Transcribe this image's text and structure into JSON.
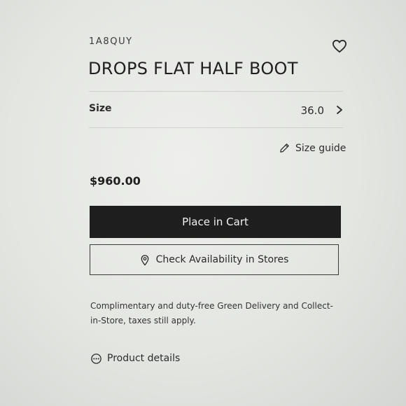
{
  "product": {
    "sku": "1A8QUY",
    "title": "DROPS FLAT HALF BOOT",
    "price": "$960.00"
  },
  "size": {
    "label": "Size",
    "value": "36.0"
  },
  "size_guide": {
    "label": "Size guide"
  },
  "actions": {
    "cart_label": "Place in Cart",
    "stores_label": "Check Availability in Stores"
  },
  "delivery_info": "Complimentary and duty-free Green Delivery and Collect-in-Store, taxes still apply.",
  "details": {
    "label": "Product details"
  },
  "icons": {
    "wishlist": "heart-icon",
    "size_chevron": "chevron-right-icon",
    "size_guide": "pencil-icon",
    "stores": "location-pin-icon",
    "details": "more-dots-icon"
  },
  "colors": {
    "cart_button_bg": "#1e1e1e",
    "cart_button_text": "#f1f1f1",
    "text": "#2a2a2a"
  }
}
